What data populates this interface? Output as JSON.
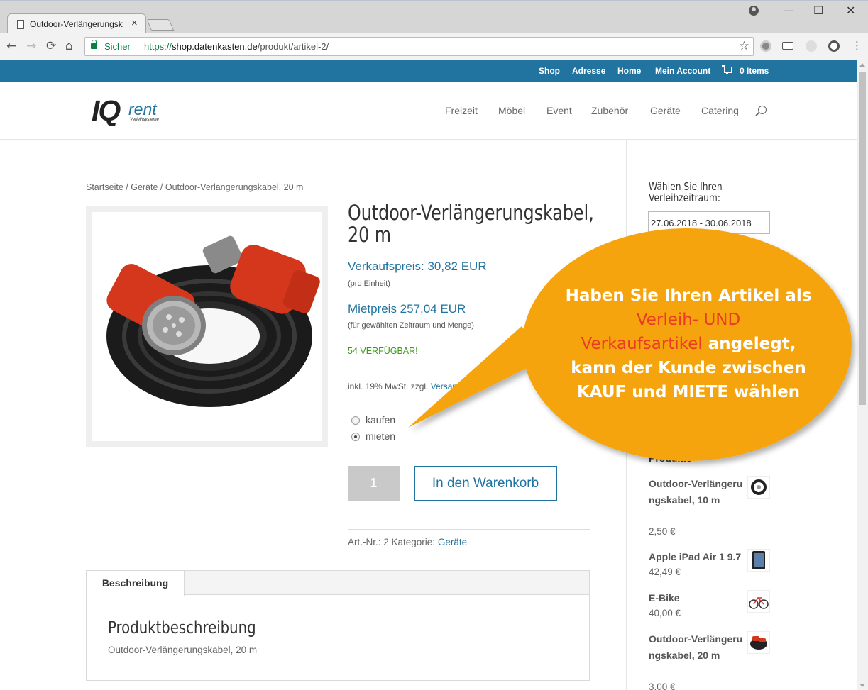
{
  "browser": {
    "tab_title": "Outdoor-Verlängerungsk",
    "tab_close": "×",
    "win_min": "—",
    "win_max": "☐",
    "win_close": "✕",
    "back": "←",
    "forward": "→",
    "reload": "⟳",
    "home": "⌂",
    "secure_label": "Sicher",
    "url_scheme": "https://",
    "url_host": "shop.datenkasten.de",
    "url_path": "/produkt/artikel-2/",
    "star": "☆"
  },
  "topbar": {
    "links": [
      "Shop",
      "Adresse",
      "Home",
      "Mein Account"
    ],
    "cart_label": "0 Items",
    "color": "#2173a0"
  },
  "logo": {
    "iq": "IQ",
    "rent": "rent",
    "sub": "Verleihsysteme"
  },
  "mainnav": [
    "Freizeit",
    "Möbel",
    "Event",
    "Zubehör",
    "Geräte",
    "Catering"
  ],
  "breadcrumb": "Startseite / Geräte / Outdoor-Verlängerungskabel, 20 m",
  "product": {
    "title_line1": "Outdoor-Verlängerungskabel,",
    "title_line2": "20 m",
    "sale_price": "Verkaufspreis: 30,82 EUR",
    "sale_note": "(pro Einheit)",
    "rent_price": "Mietpreis 257,04 EUR",
    "rent_note": "(für gewählten Zeitraum und Menge)",
    "stock": "54 VERFÜGBAR!",
    "tax_prefix": "inkl. 19% MwSt. zzgl. ",
    "tax_link": "Versand",
    "options": [
      {
        "label": "kaufen",
        "checked": false
      },
      {
        "label": "mieten",
        "checked": true
      }
    ],
    "quantity": "1",
    "add_to_cart": "In den Warenkorb",
    "sku_label": "Art.-Nr.: 2 Kategorie: ",
    "category": "Geräte"
  },
  "tabs": {
    "active": "Beschreibung",
    "desc_title": "Produktbeschreibung",
    "desc_text": "Outdoor-Verlängerungskabel, 20 m"
  },
  "sidebar": {
    "period_title_l1": "Wählen Sie Ihren",
    "period_title_l2": "Verleihzeitraum:",
    "period_value": "27.06.2018 - 30.06.2018",
    "products_title": "Produkte",
    "products": [
      {
        "name": "Outdoor-Verlängerungskabel, 10 m",
        "price": "2,50 €"
      },
      {
        "name": "Apple iPad Air 1 9.7",
        "price": "42,49 €"
      },
      {
        "name": "E-Bike",
        "price": "40,00 €"
      },
      {
        "name": "Outdoor-Verlängerungskabel, 20 m",
        "price": "3,00 €"
      }
    ]
  },
  "callout": {
    "line1": "Haben Sie Ihren Artikel als",
    "red1": "Verleih- UND",
    "red2": "Verkaufsartikel",
    "line3_rest": " angelegt,",
    "line4": "kann der Kunde zwischen",
    "line5": "KAUF und MIETE wählen",
    "color": "#f5a40d",
    "highlight_color": "#ea3c24"
  }
}
